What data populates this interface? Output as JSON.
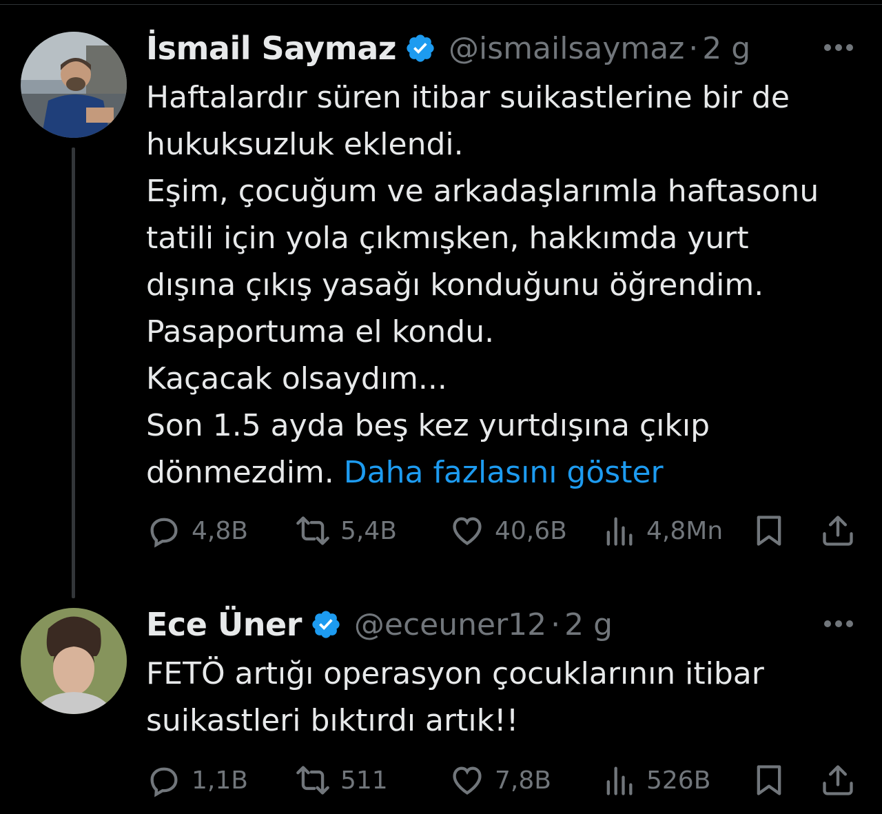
{
  "tweets": [
    {
      "name": "İsmail Saymaz",
      "handle": "@ismailsaymaz",
      "separator": "·",
      "time": "2 g",
      "lines": [
        "Haftalardır süren itibar suikastlerine bir de",
        "hukuksuzluk eklendi.",
        "Eşim, çocuğum ve arkadaşlarımla haftasonu",
        "tatili için yola çıkmışken, hakkımda yurt",
        "dışına çıkış yasağı konduğunu öğrendim.",
        "Pasaportuma el kondu.",
        "Kaçacak olsaydım...",
        "Son 1.5 ayda beş kez yurtdışına çıkıp",
        "dönmezdim."
      ],
      "show_more": "Daha fazlasını göster",
      "stats": {
        "replies": "4,8B",
        "retweets": "5,4B",
        "likes": "40,6B",
        "views": "4,8Mn"
      }
    },
    {
      "name": "Ece Üner",
      "handle": "@eceuner12",
      "separator": "·",
      "time": "2 g",
      "lines": [
        "FETÖ artığı operasyon çocuklarının itibar",
        "suikastleri bıktırdı artık!!"
      ],
      "stats": {
        "replies": "1,1B",
        "retweets": "511",
        "likes": "7,8B",
        "views": "526B"
      }
    }
  ],
  "colors": {
    "background": "#000000",
    "text": "#e7e9ea",
    "muted": "#71767b",
    "link": "#1d9bf0",
    "verified": "#1d9bf0"
  }
}
